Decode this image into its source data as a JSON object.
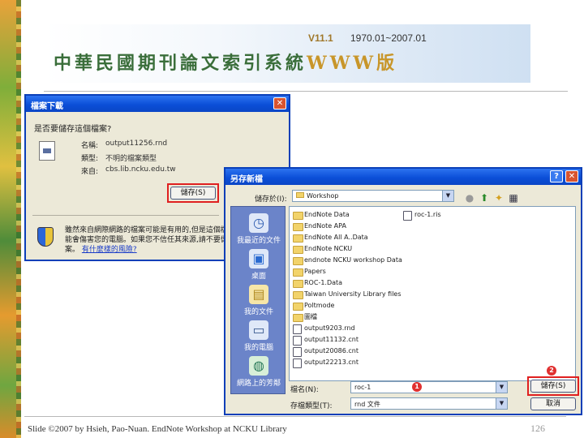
{
  "banner": {
    "version": "V11.1",
    "range": "1970.01~2007.01",
    "title_main": "中華民國期刊論文索引系統",
    "title_suffix": "WWW版"
  },
  "download_dialog": {
    "title": "檔案下載",
    "question": "是否要儲存這個檔案?",
    "name_label": "名稱:",
    "name_value": "output11256.rnd",
    "type_label": "類型:",
    "type_value": "不明的檔案類型",
    "from_label": "來自:",
    "from_value": "cbs.lib.ncku.edu.tw",
    "save_button": "儲存(S)",
    "warning_text": "雖然來自網際網路的檔案可能是有用的,但是這個檔案類型可能會傷害您的電腦。如果您不信任其來源,請不要儲存這個檔案。",
    "warning_link": "有什麼樣的風險?"
  },
  "save_dialog": {
    "title": "另存新檔",
    "save_in_label": "儲存於(I):",
    "save_in_value": "Workshop",
    "places": [
      {
        "label": "我最近的文件",
        "icon": "recent-documents-icon"
      },
      {
        "label": "桌面",
        "icon": "desktop-icon"
      },
      {
        "label": "我的文件",
        "icon": "my-documents-icon"
      },
      {
        "label": "我的電腦",
        "icon": "my-computer-icon"
      },
      {
        "label": "網路上的芳鄰",
        "icon": "network-places-icon"
      }
    ],
    "files": [
      {
        "name": "EndNote Data",
        "kind": "folder"
      },
      {
        "name": "EndNote APA",
        "kind": "folder"
      },
      {
        "name": "EndNote All A..Data",
        "kind": "folder"
      },
      {
        "name": "EndNote NCKU",
        "kind": "folder"
      },
      {
        "name": "endnote NCKU workshop Data",
        "kind": "folder"
      },
      {
        "name": "Papers",
        "kind": "folder"
      },
      {
        "name": "ROC-1.Data",
        "kind": "folder"
      },
      {
        "name": "Taiwan University Library files",
        "kind": "folder"
      },
      {
        "name": "Poltmode",
        "kind": "folder"
      },
      {
        "name": "圖檔",
        "kind": "folder"
      },
      {
        "name": "output9203.rnd",
        "kind": "doc"
      },
      {
        "name": "output11132.cnt",
        "kind": "doc"
      },
      {
        "name": "output20086.cnt",
        "kind": "doc"
      },
      {
        "name": "output22213.cnt",
        "kind": "doc"
      },
      {
        "name": "roc-1.ris",
        "kind": "doc"
      }
    ],
    "filename_label": "檔名(N):",
    "filename_value": "roc-1",
    "filetype_label": "存檔類型(T):",
    "filetype_value": "rnd 文件",
    "save_button": "儲存(S)",
    "cancel_button": "取消",
    "marker_1": "1",
    "marker_2": "2"
  },
  "footer": {
    "credit": "Slide ©2007 by Hsieh, Pao-Nuan. EndNote Workshop at NCKU Library",
    "page_number": "126"
  }
}
